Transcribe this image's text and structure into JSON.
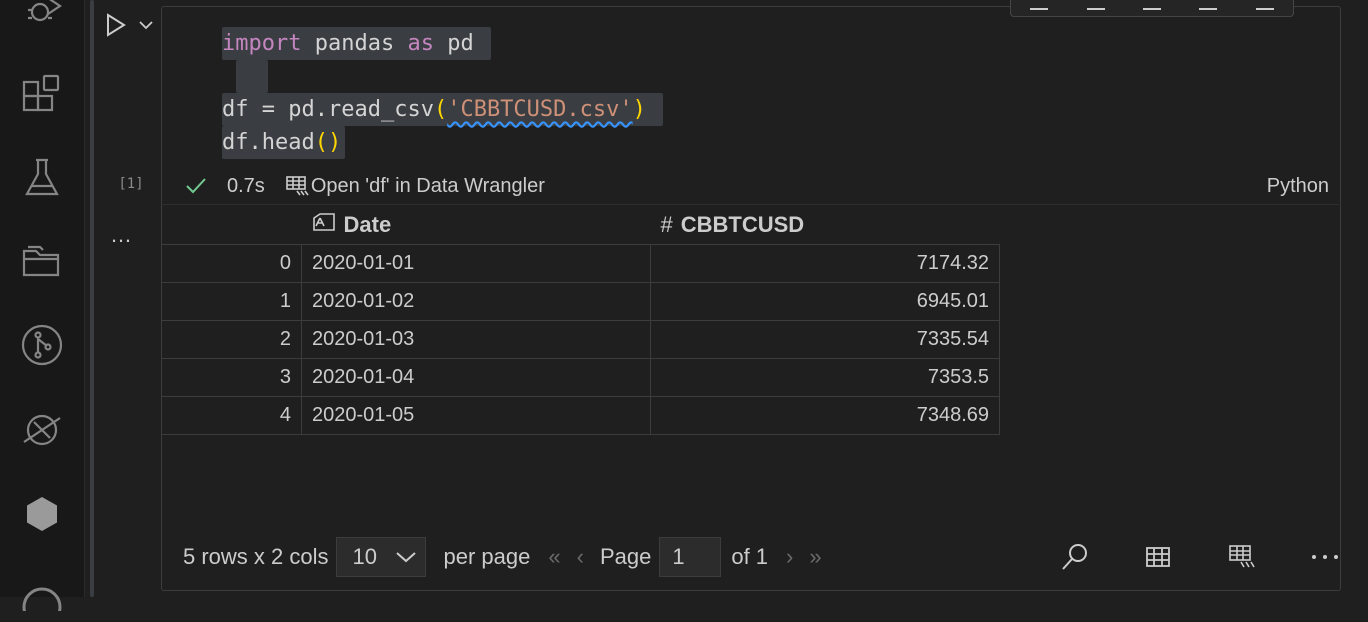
{
  "activity_bar": {
    "items": [
      {
        "icon": "run-debug-icon"
      },
      {
        "icon": "extensions-icon"
      },
      {
        "icon": "testing-flask-icon"
      },
      {
        "icon": "folders-icon"
      },
      {
        "icon": "source-control-icon"
      },
      {
        "icon": "remote-explorer-icon"
      },
      {
        "icon": "hexagon-icon"
      },
      {
        "icon": "account-icon"
      }
    ]
  },
  "cell": {
    "execution_count": "[1]",
    "more_output_label": "…",
    "code": {
      "line1": {
        "kw1": "import",
        "mod": "pandas",
        "kw2": "as",
        "alias": "pd"
      },
      "line3": {
        "lhs": "df",
        "op": "=",
        "call": "pd.read_csv",
        "open": "(",
        "arg": "'CBBTCUSD.csv'",
        "close": ")"
      },
      "line4": {
        "call": "df.head",
        "parens": "()"
      }
    },
    "status": {
      "duration": "0.7s",
      "data_wrangler_label": "Open 'df' in Data Wrangler",
      "language": "Python"
    }
  },
  "dataframe": {
    "columns": [
      {
        "label": "",
        "icon": ""
      },
      {
        "label": "Date",
        "icon": "text-type-icon"
      },
      {
        "label": "CBBTCUSD",
        "icon": "#"
      }
    ],
    "rows": [
      {
        "index": "0",
        "date": "2020-01-01",
        "value": "7174.32"
      },
      {
        "index": "1",
        "date": "2020-01-02",
        "value": "6945.01"
      },
      {
        "index": "2",
        "date": "2020-01-03",
        "value": "7335.54"
      },
      {
        "index": "3",
        "date": "2020-01-04",
        "value": "7353.5"
      },
      {
        "index": "4",
        "date": "2020-01-05",
        "value": "7348.69"
      }
    ]
  },
  "pager": {
    "summary": "5 rows x 2 cols",
    "per_page_value": "10",
    "per_page_label": "per page",
    "first": "«",
    "prev": "‹",
    "page_label": "Page",
    "page_value": "1",
    "of_label": "of 1",
    "next": "›",
    "last": "»"
  },
  "colors": {
    "keyword": "#c586c0",
    "string": "#ce9178",
    "bracket": "#ffd700",
    "success": "#73c991",
    "background": "#1f1f1f"
  }
}
